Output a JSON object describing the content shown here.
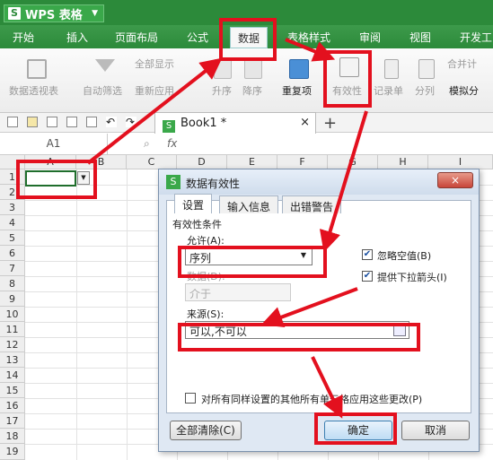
{
  "app": {
    "title": "WPS 表格",
    "logo_letter": "S"
  },
  "menu": [
    {
      "label": "开始"
    },
    {
      "label": "插入"
    },
    {
      "label": "页面布局"
    },
    {
      "label": "公式"
    },
    {
      "label": "数据"
    },
    {
      "label": "表格样式"
    },
    {
      "label": "审阅"
    },
    {
      "label": "视图"
    },
    {
      "label": "开发工"
    }
  ],
  "ribbon": {
    "pivot": "数据透视表",
    "autofilter": "自动筛选",
    "show_all": "全部显示",
    "reapply": "重新应用",
    "sort_asc": "升序",
    "sort_desc": "降序",
    "duplicates": "重复项",
    "validity": "有效性",
    "record": "记录单",
    "split": "分列",
    "merge_calc": "合并计",
    "simulate": "模拟分"
  },
  "tabs": {
    "book": "Book1 *",
    "close": "×",
    "new": "+"
  },
  "formula": {
    "namebox": "A1",
    "fx": "fx"
  },
  "sheet": {
    "columns": [
      "A",
      "B",
      "C",
      "D",
      "E",
      "F",
      "G",
      "H",
      "I"
    ],
    "rows": [
      "1",
      "2",
      "3",
      "4",
      "5",
      "6",
      "7",
      "8",
      "9",
      "10",
      "11",
      "12",
      "13",
      "14",
      "15",
      "16",
      "17",
      "18",
      "19"
    ]
  },
  "dialog": {
    "title": "数据有效性",
    "close": "×",
    "tabs": [
      "设置",
      "输入信息",
      "出错警告"
    ],
    "group_title": "有效性条件",
    "allow_label": "允许(A):",
    "allow_value": "序列",
    "data_label": "数据(D):",
    "data_value": "介于",
    "ignore_blank": "忽略空值(B)",
    "dropdown_arrow": "提供下拉箭头(I)",
    "source_label": "来源(S):",
    "source_value": "可以,不可以",
    "apply_all": "对所有同样设置的其他所有单元格应用这些更改(P)",
    "clear_all": "全部清除(C)",
    "ok": "确定",
    "cancel": "取消"
  },
  "colors": {
    "brand": "#2c8a3a",
    "highlight": "#e3101e"
  }
}
